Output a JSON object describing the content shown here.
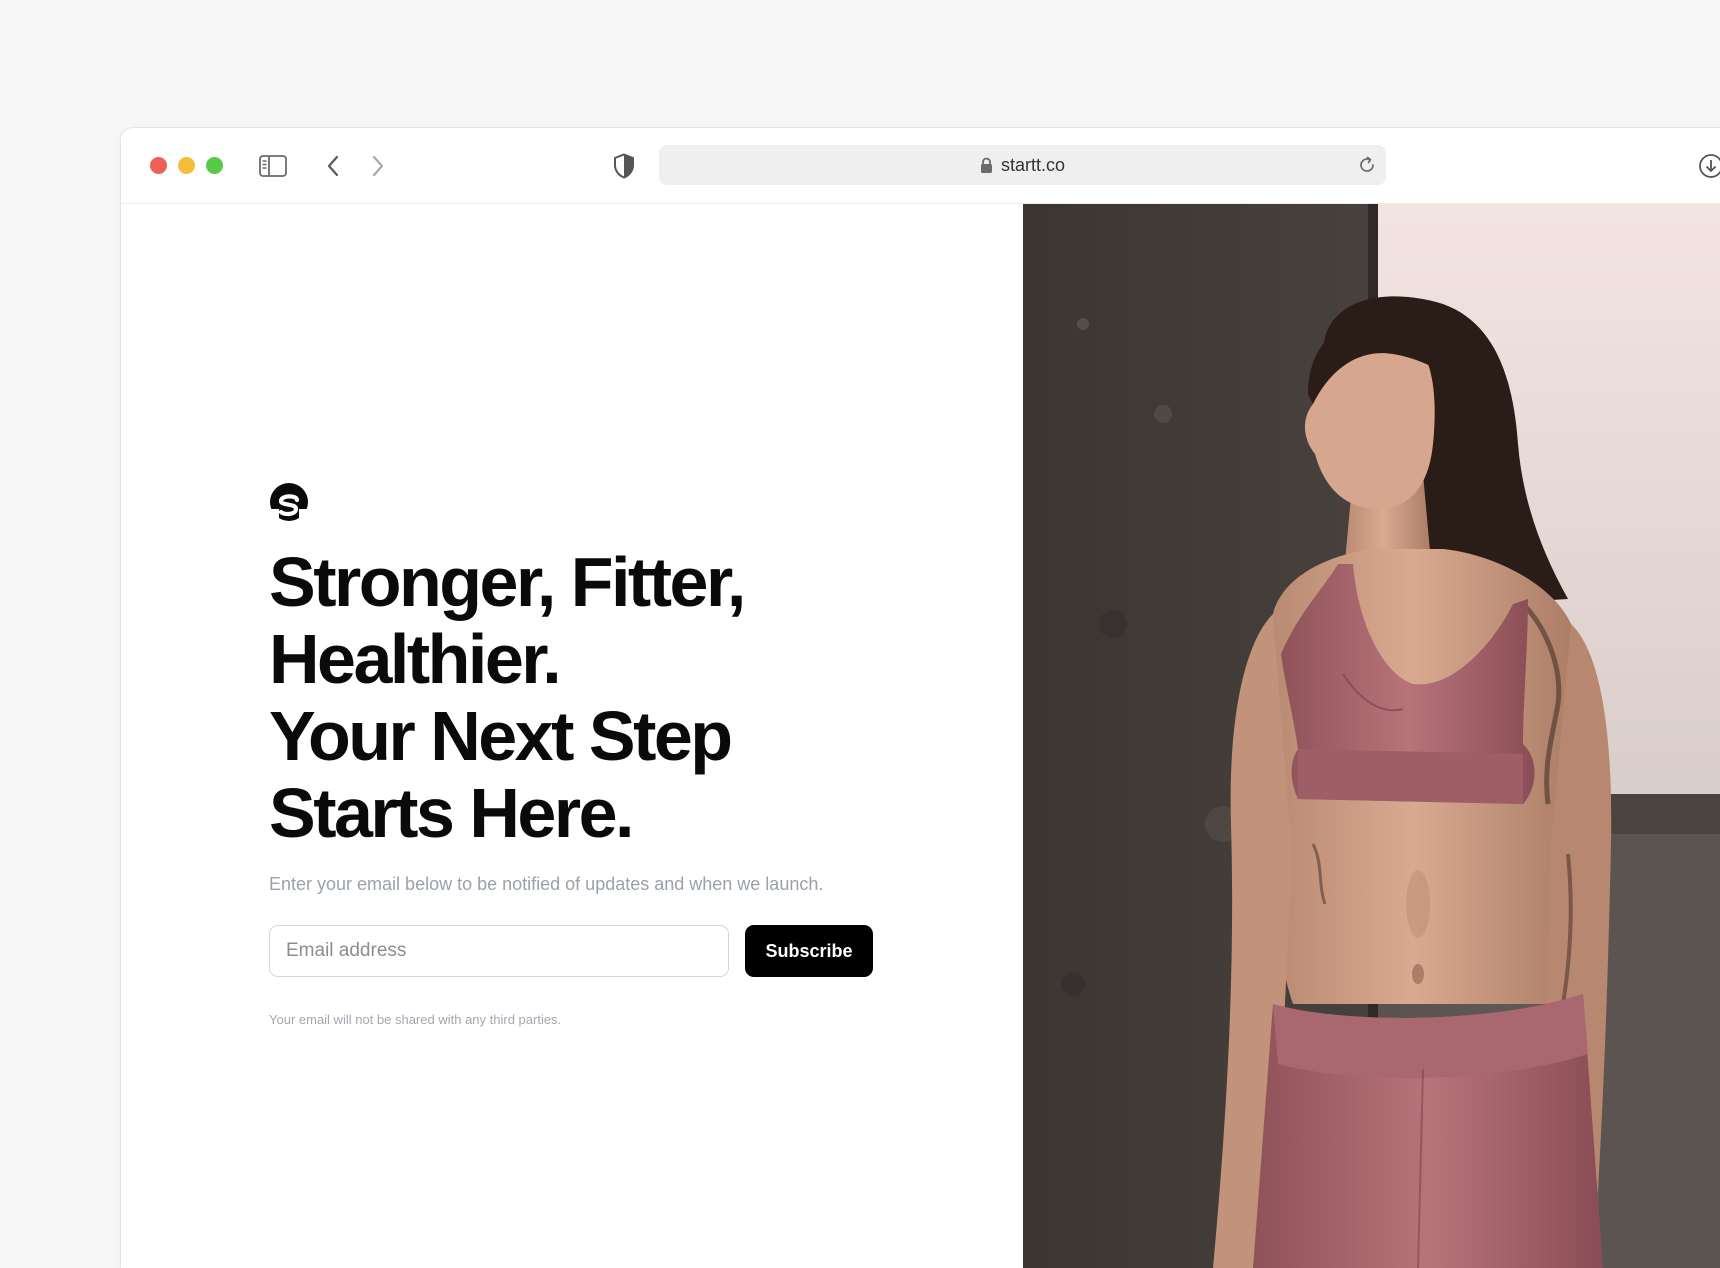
{
  "browser": {
    "url": "startt.co"
  },
  "hero": {
    "headline_lines": [
      "Stronger, Fitter,",
      "Healthier.",
      "Your Next Step",
      "Starts Here."
    ],
    "subtext": "Enter your email below to be notified of updates and when we launch.",
    "email_placeholder": "Email address",
    "subscribe_label": "Subscribe",
    "privacy_note": "Your email will not be shared with any third parties."
  },
  "icons": {
    "sidebar": "sidebar-toggle-icon",
    "back": "chevron-left-icon",
    "forward": "chevron-right-icon",
    "shield": "shield-icon",
    "lock": "lock-icon",
    "reload": "reload-icon",
    "download": "download-icon",
    "logo": "brand-logo-icon"
  },
  "colors": {
    "traffic_red": "#ee5f57",
    "traffic_yellow": "#f4bd3a",
    "traffic_green": "#5ac849",
    "button_bg": "#000000",
    "button_text": "#ffffff",
    "outfit": "#b06d73"
  }
}
